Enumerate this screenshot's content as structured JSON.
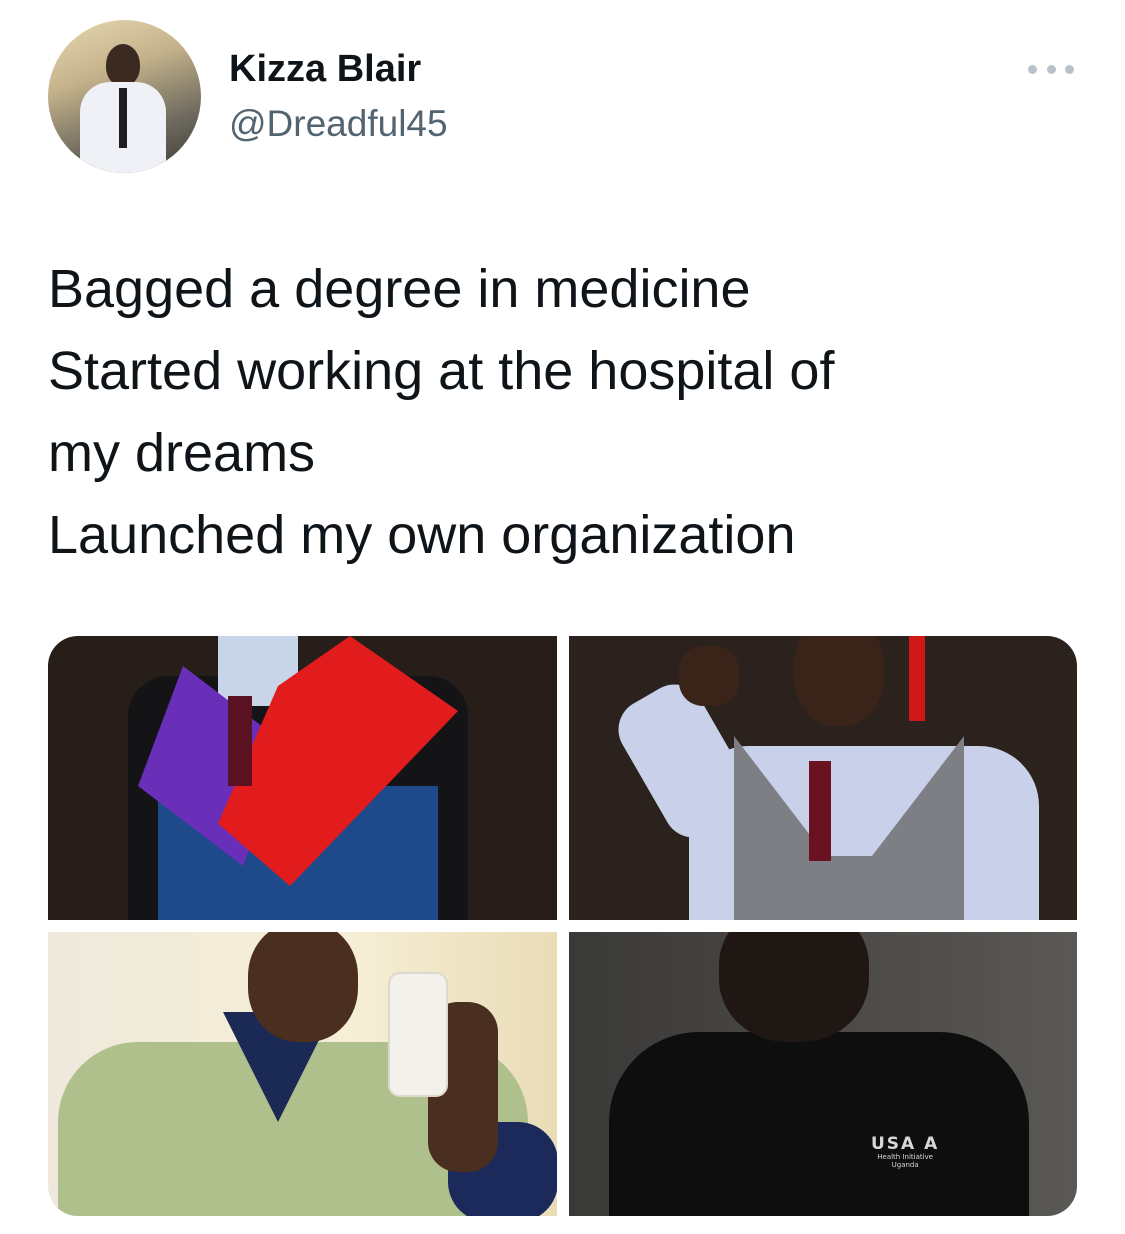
{
  "author": {
    "name": "Kizza Blair",
    "handle": "@Dreadful45"
  },
  "tweet": {
    "text": "Bagged a degree in medicine\nStarted working at the hospital of\nmy dreams\nLaunched my own organization"
  },
  "menu": {
    "icon": "more-horizontal-icon"
  },
  "media": {
    "photos": [
      {
        "description": "graduation-gown"
      },
      {
        "description": "vest-and-tie"
      },
      {
        "description": "scrubs-selfie"
      },
      {
        "description": "black-polo"
      }
    ],
    "polo_logo": {
      "main": "USA A",
      "line1": "Health Initiative",
      "line2": "Uganda"
    }
  }
}
